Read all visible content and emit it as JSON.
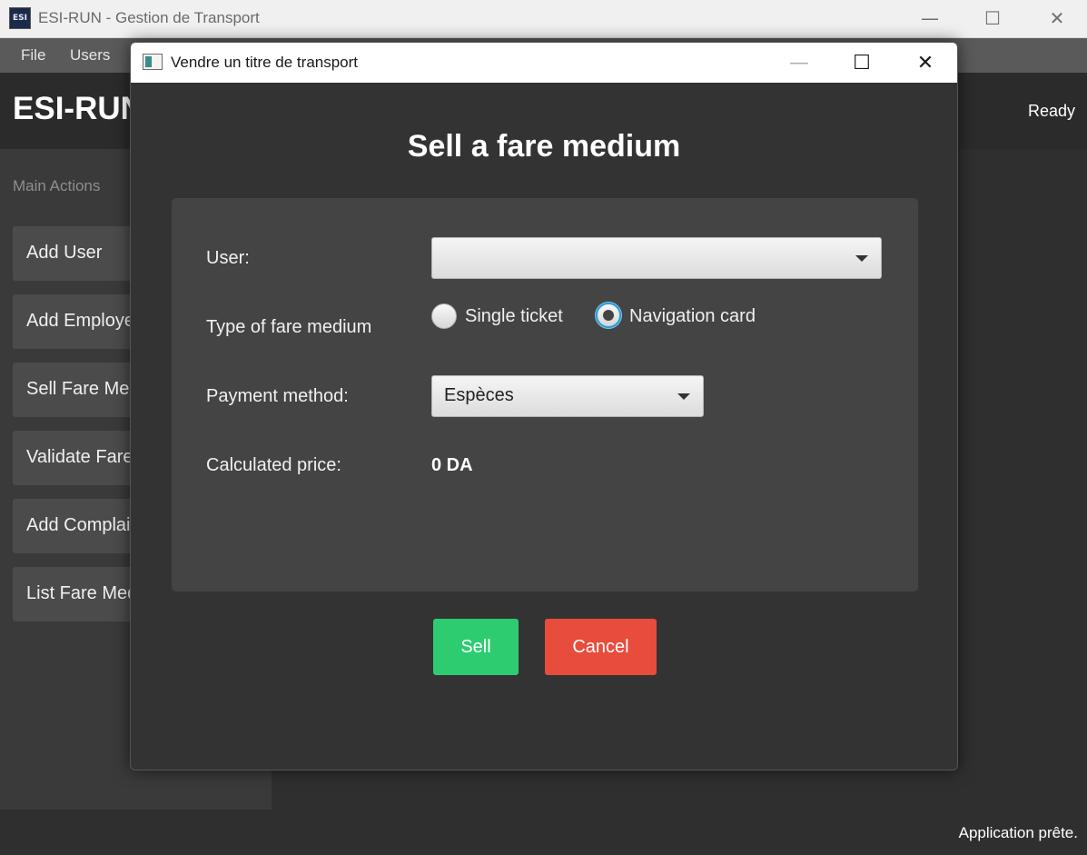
{
  "main_window": {
    "title": "ESI-RUN - Gestion de Transport",
    "app_icon_text": "ESI",
    "menu": [
      "File",
      "Users"
    ],
    "brand": "ESI-RUN",
    "ready_label": "Ready",
    "status_text": "Application prête.",
    "controls": {
      "minimize": "—",
      "maximize": "☐",
      "close": "✕"
    }
  },
  "sidebar": {
    "heading": "Main Actions",
    "items": [
      {
        "label": "Add User"
      },
      {
        "label": "Add Employee"
      },
      {
        "label": "Sell Fare Medium"
      },
      {
        "label": "Validate Fare Medium"
      },
      {
        "label": "Add Complaint"
      },
      {
        "label": "List Fare Media"
      }
    ]
  },
  "dialog": {
    "title": "Vendre un titre de transport",
    "controls": {
      "minimize": "—",
      "maximize": "☐",
      "close": "✕"
    },
    "heading": "Sell a fare medium",
    "form": {
      "user_label": "User:",
      "user_value": "",
      "type_label": "Type of fare medium",
      "type_options": [
        {
          "label": "Single ticket",
          "selected": false
        },
        {
          "label": "Navigation card",
          "selected": true
        }
      ],
      "payment_label": "Payment method:",
      "payment_value": "Espèces",
      "price_label": "Calculated price:",
      "price_value": "0 DA"
    },
    "buttons": {
      "sell": "Sell",
      "cancel": "Cancel"
    },
    "colors": {
      "sell": "#2ecc71",
      "cancel": "#e74c3c",
      "radio_focus": "#2aa1d8"
    }
  }
}
